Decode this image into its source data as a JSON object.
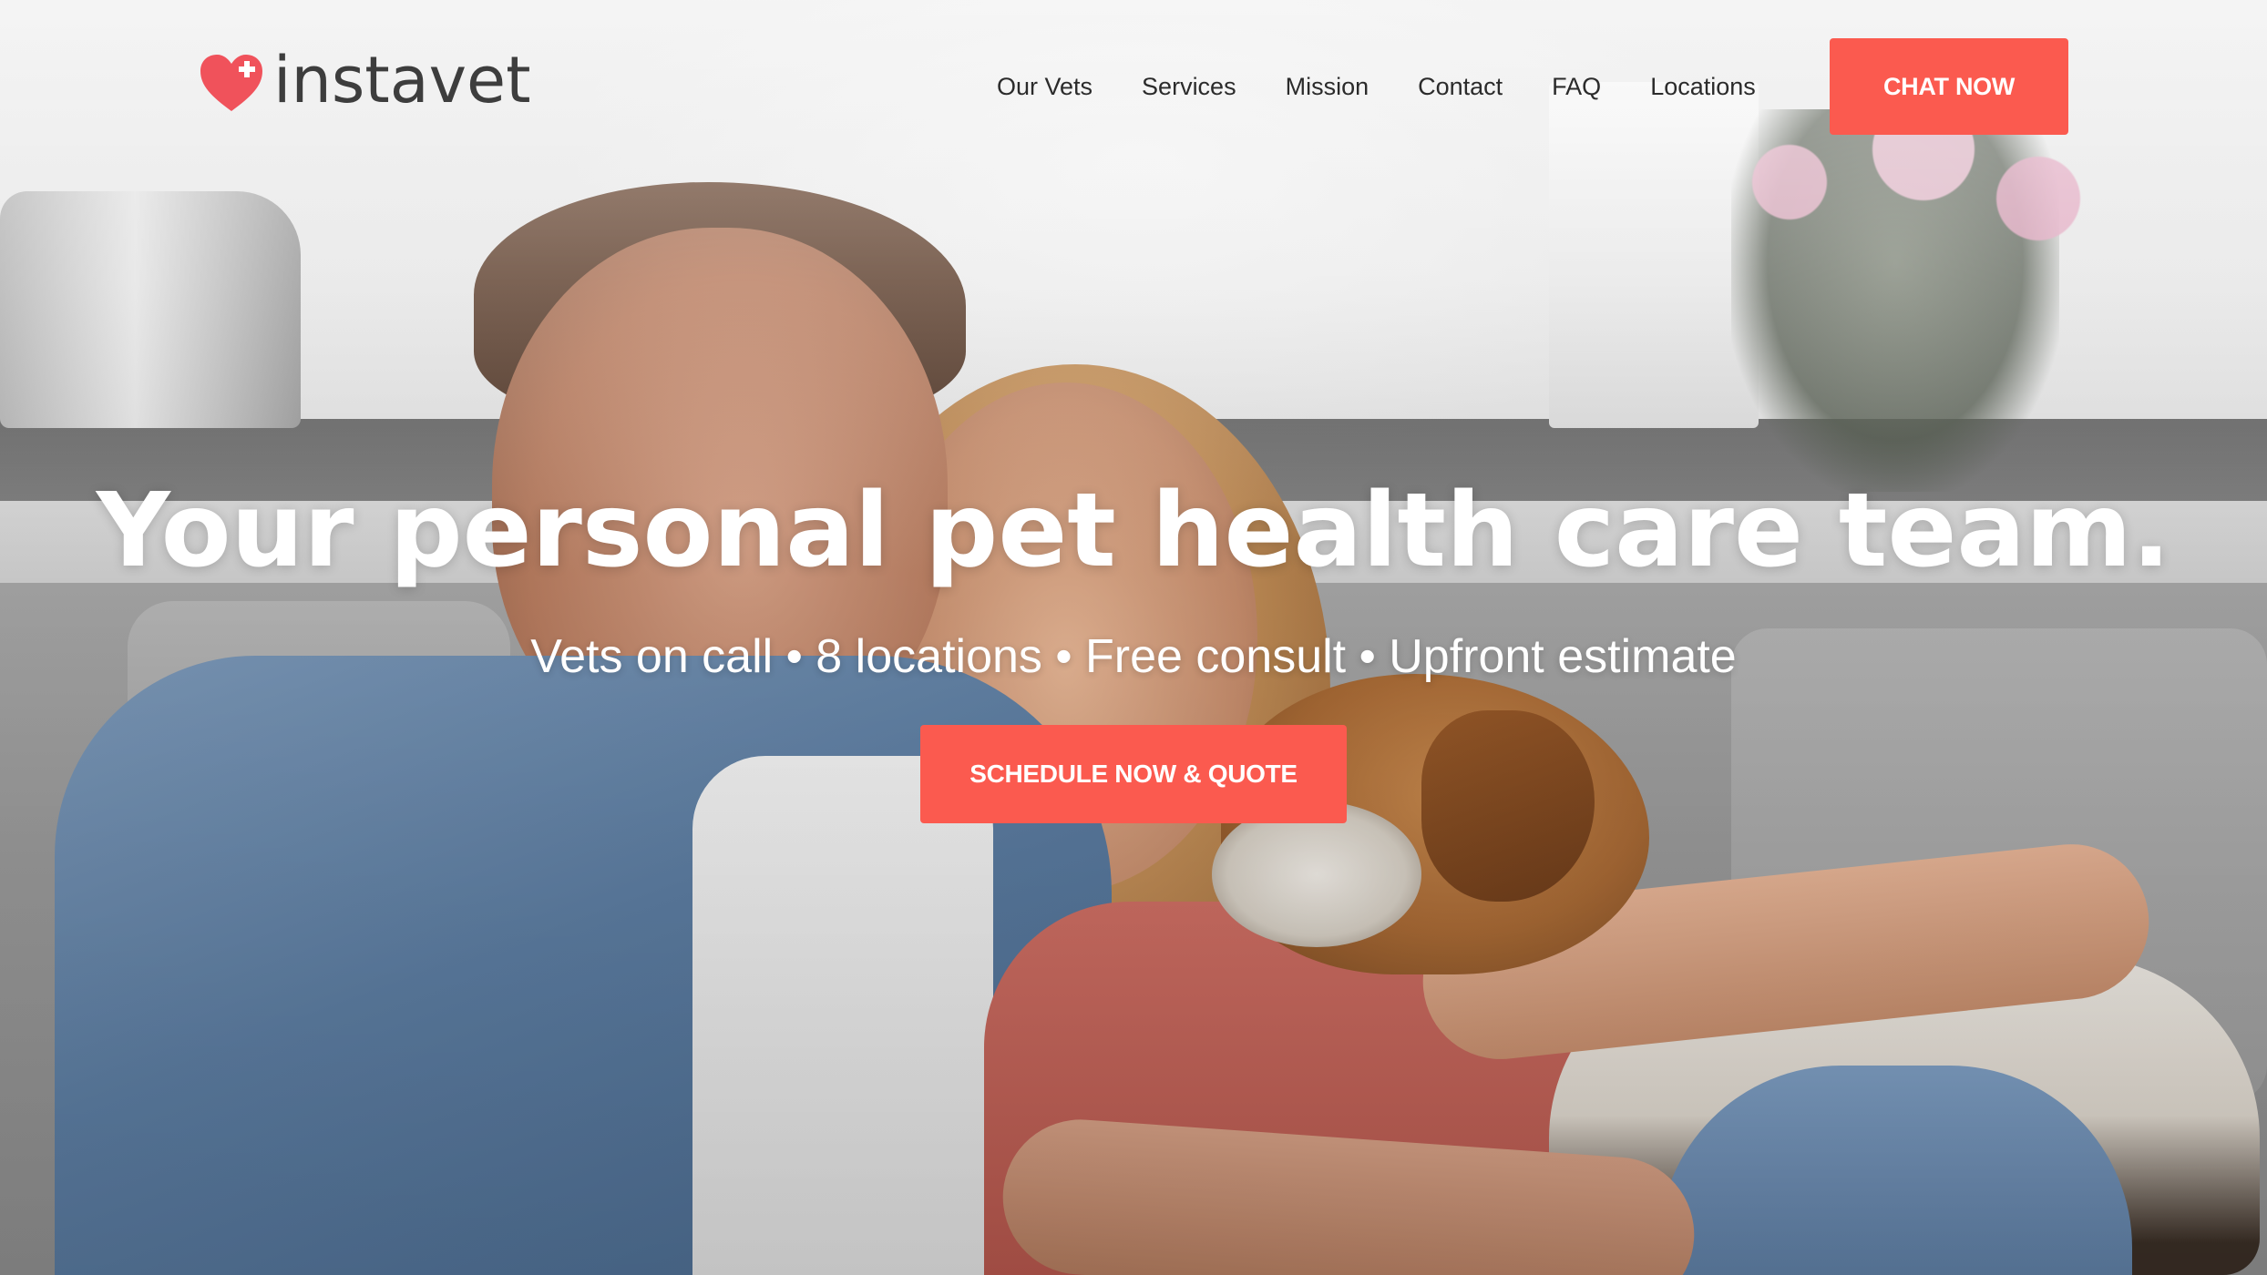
{
  "brand": {
    "name": "instavet",
    "accent_color": "#fb5a4f",
    "logo_icon": "heart-plus-icon"
  },
  "nav": {
    "items": [
      {
        "label": "Our Vets"
      },
      {
        "label": "Services"
      },
      {
        "label": "Mission"
      },
      {
        "label": "Contact"
      },
      {
        "label": "FAQ"
      },
      {
        "label": "Locations"
      }
    ],
    "chat_label": "CHAT NOW"
  },
  "hero": {
    "title": "Your personal pet health care team.",
    "subtitle": "Vets on call • 8 locations • Free consult • Upfront estimate",
    "cta_label": "SCHEDULE NOW & QUOTE"
  }
}
